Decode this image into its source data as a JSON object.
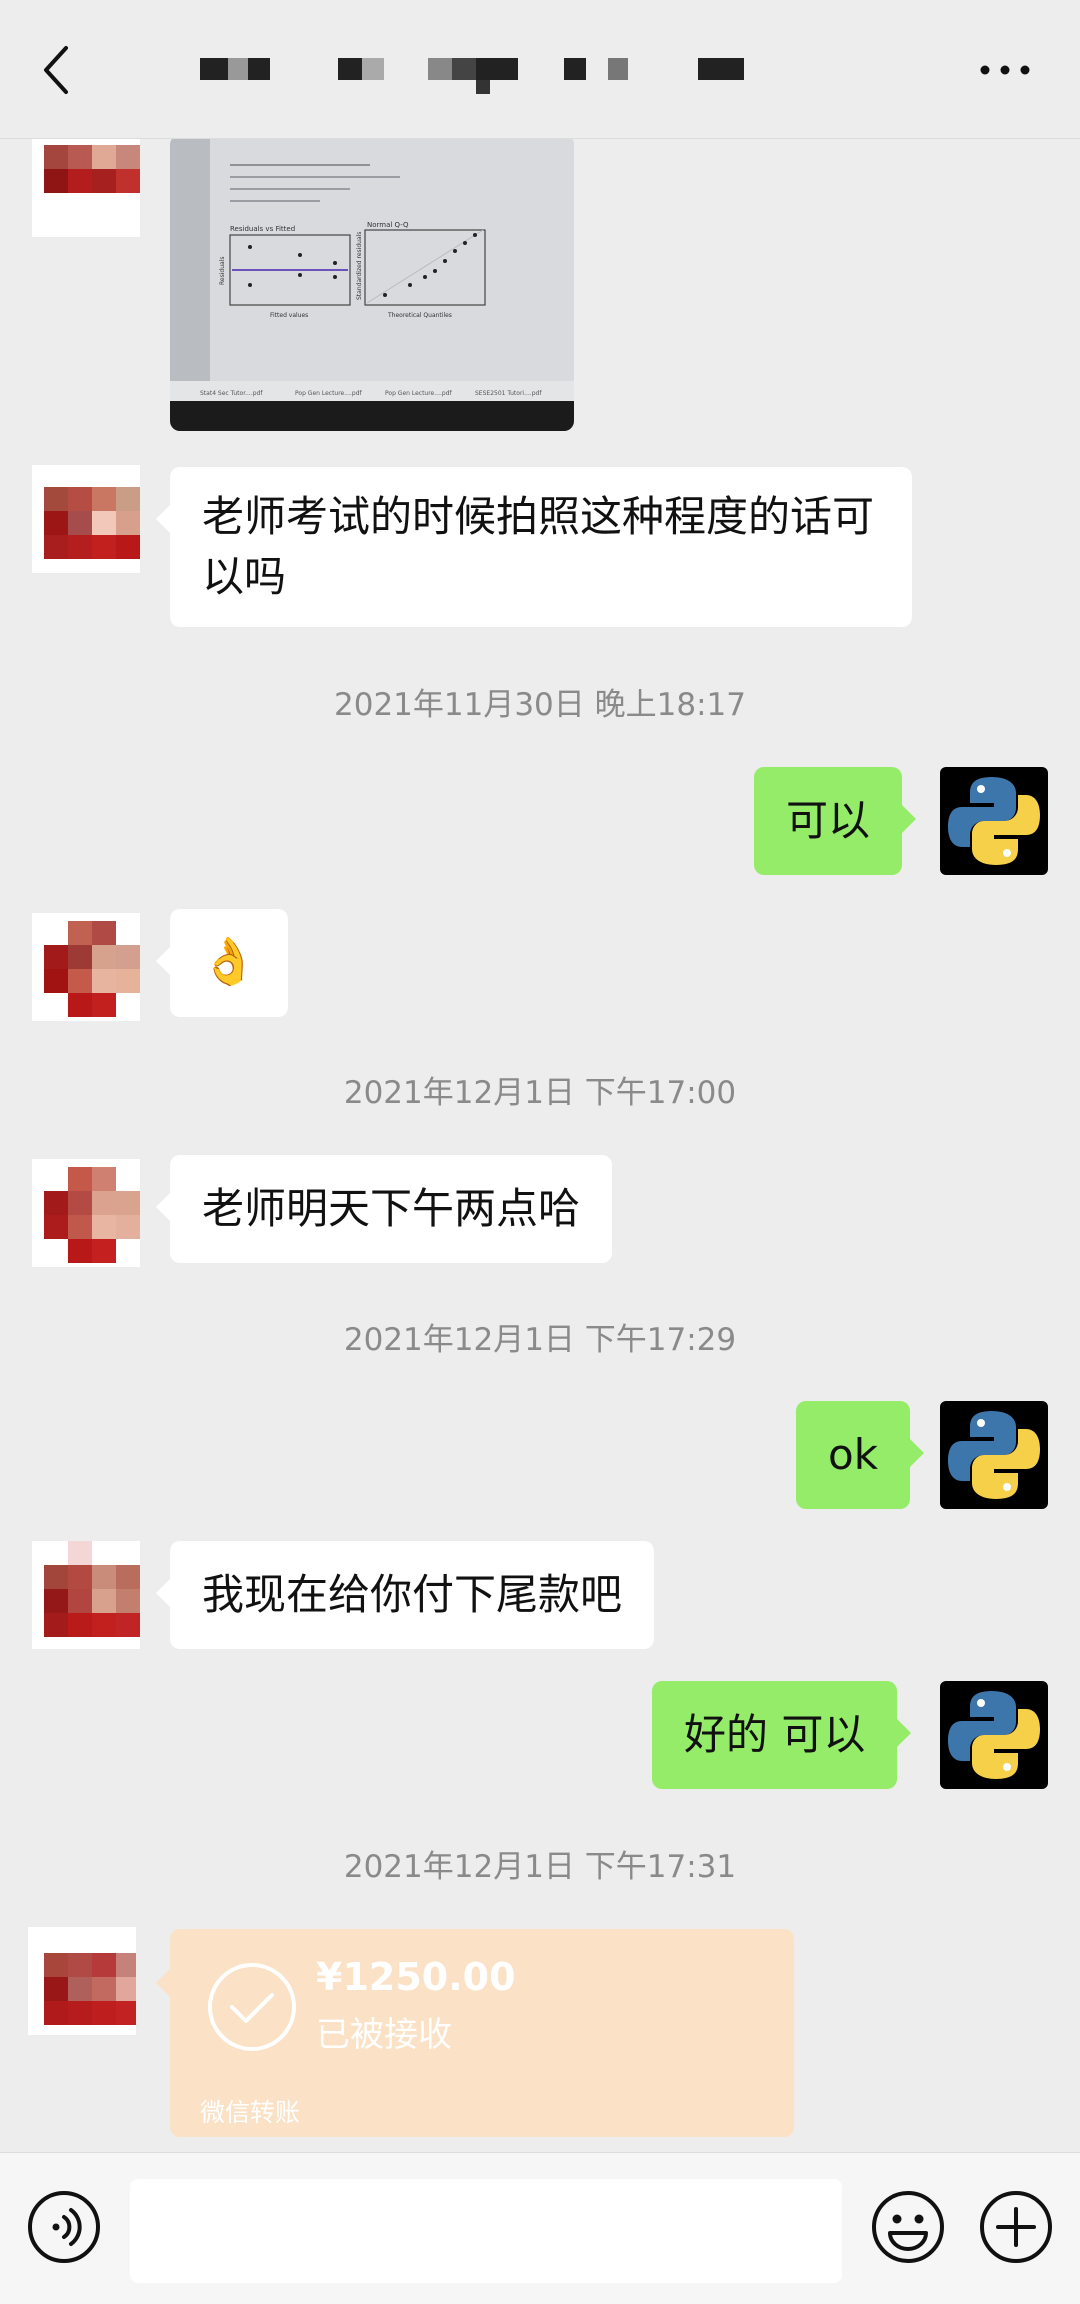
{
  "messages": {
    "m1": "老师考试的时候拍照这种程度的话可以吗",
    "ts1": "2021年11月30日 晚上18:17",
    "m2": "可以",
    "m3": "👌",
    "ts2": "2021年12月1日 下午17:00",
    "m4": "老师明天下午两点哈",
    "ts3": "2021年12月1日 下午17:29",
    "m5": "ok",
    "m6": "我现在给你付下尾款吧",
    "m7": "好的 可以",
    "ts4": "2021年12月1日 下午17:31"
  },
  "transfer": {
    "amount": "¥1250.00",
    "status": "已被接收",
    "label": "微信转账"
  },
  "photo": {
    "plot1_title": "Residuals vs Fitted",
    "plot1_xlabel": "Fitted values",
    "plot1_ylabel": "Residuals",
    "plot2_title": "Normal Q-Q",
    "plot2_xlabel": "Theoretical Quantiles",
    "plot2_ylabel": "Standardized residuals",
    "tab1": "Stat4 Sec Tutor....pdf",
    "tab2": "Pop Gen Lecture....pdf",
    "tab3": "Pop Gen Lecture....pdf",
    "tab4": "SESE2501 Tutori....pdf"
  },
  "colors": {
    "background": "#ededed",
    "outgoing_bubble": "#95ec69",
    "incoming_bubble": "#ffffff",
    "transfer_card": "#fbe1c5"
  }
}
